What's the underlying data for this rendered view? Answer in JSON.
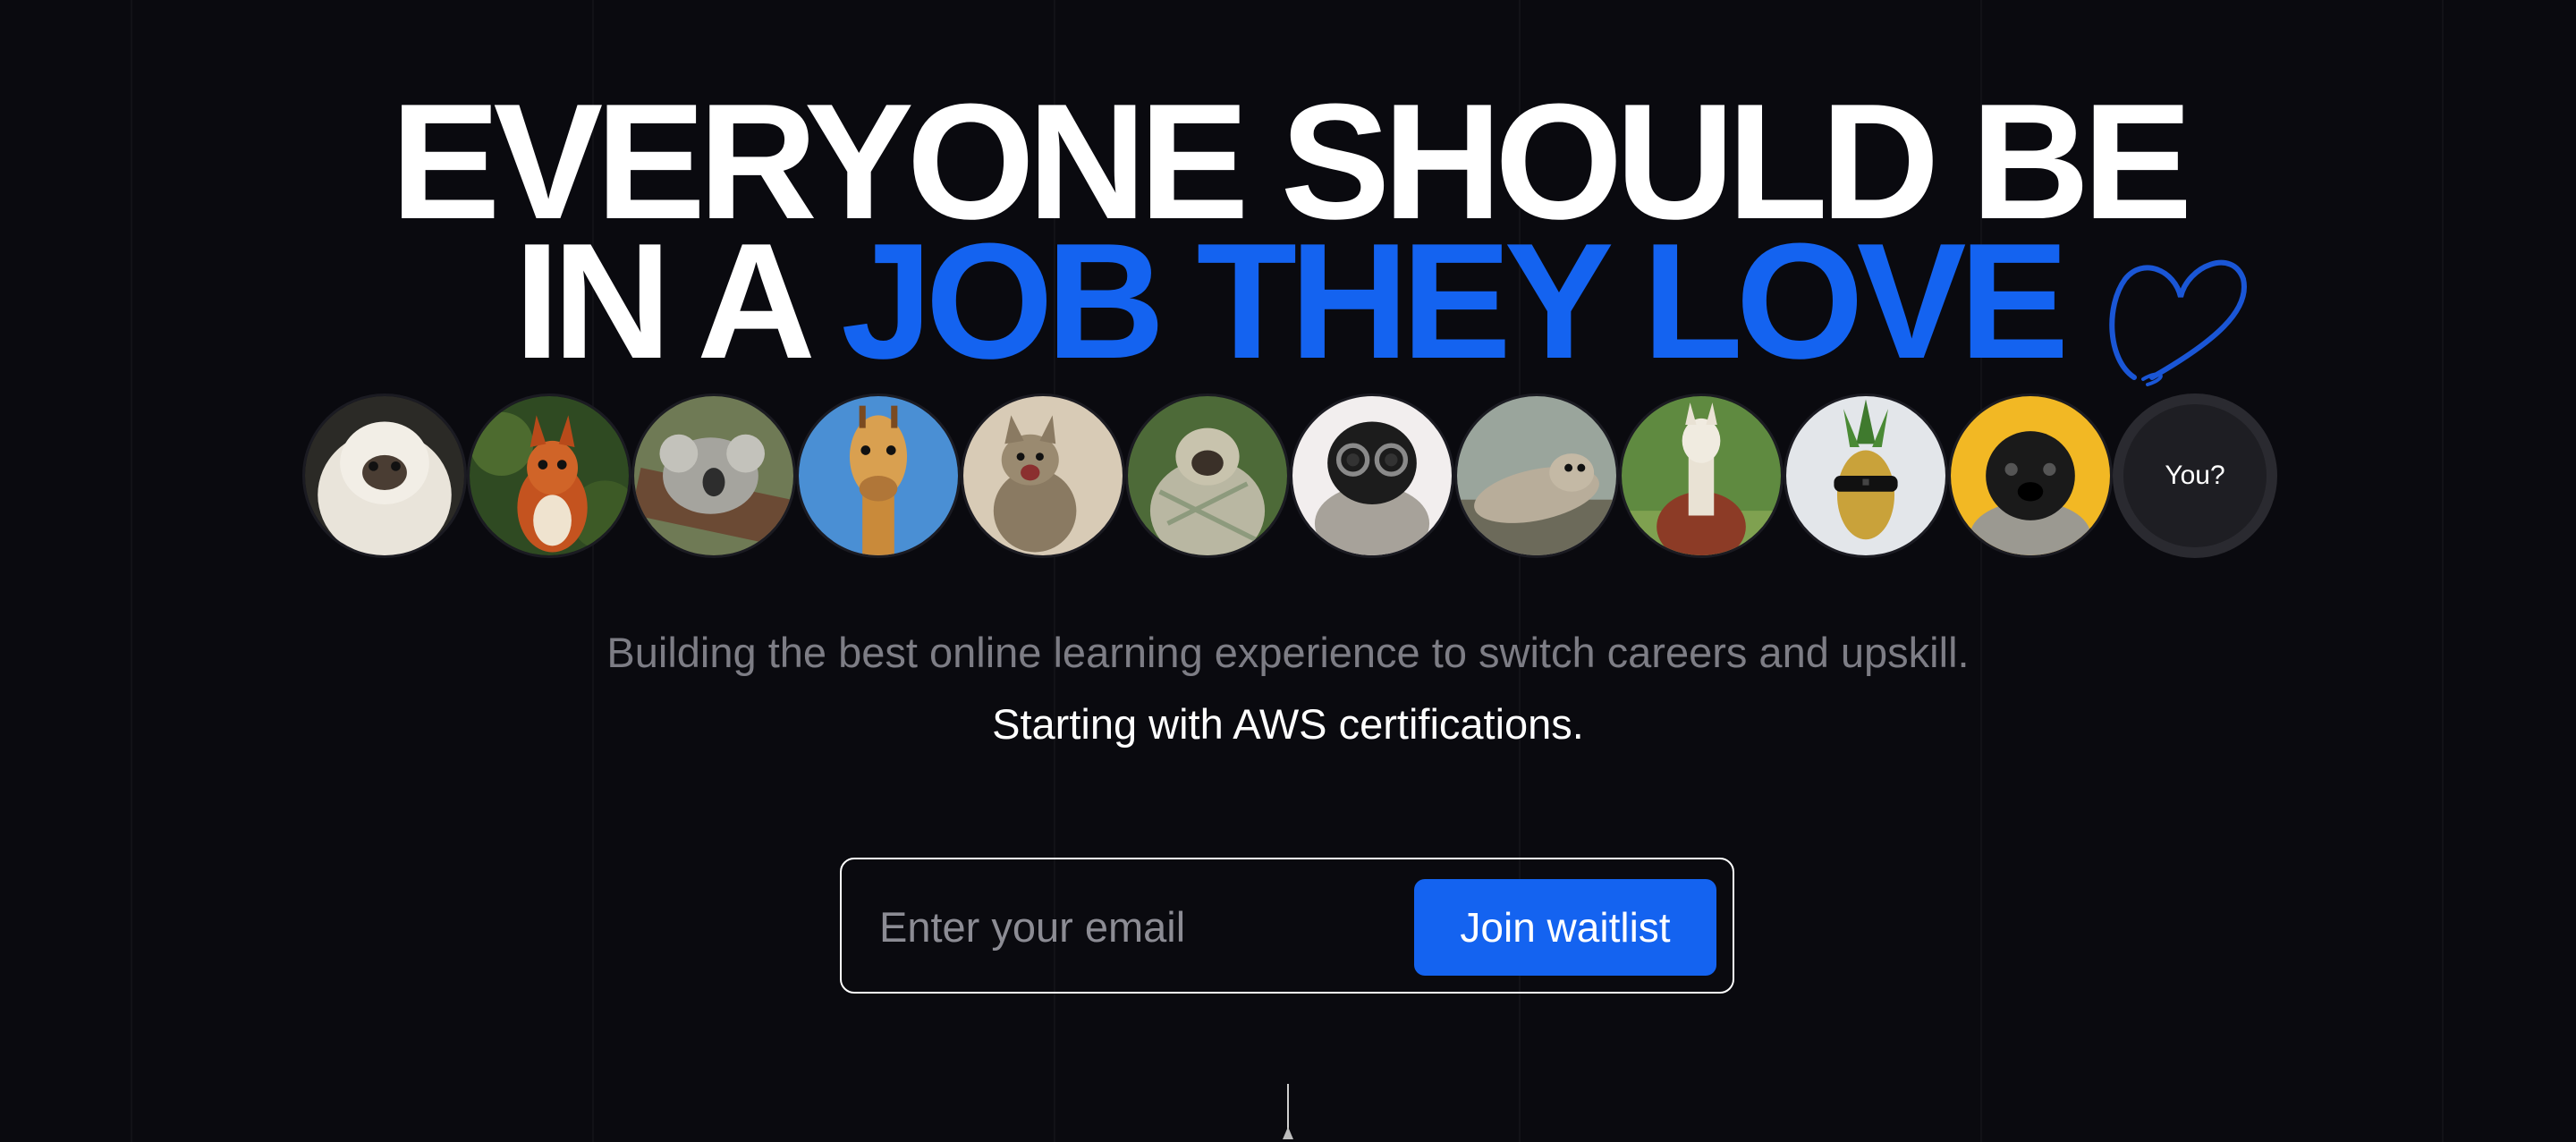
{
  "hero": {
    "line1": "EVERYONE SHOULD BE",
    "line2_prefix": "IN A ",
    "line2_accent": "JOB THEY LOVE"
  },
  "avatars": {
    "items": [
      {
        "name": "fluffy-dog-avatar"
      },
      {
        "name": "squirrel-avatar"
      },
      {
        "name": "koala-avatar"
      },
      {
        "name": "giraffe-avatar"
      },
      {
        "name": "kitten-avatar"
      },
      {
        "name": "pug-blanket-avatar"
      },
      {
        "name": "pug-glasses-avatar"
      },
      {
        "name": "seal-avatar"
      },
      {
        "name": "alpaca-avatar"
      },
      {
        "name": "pineapple-avatar"
      },
      {
        "name": "pug-yellow-avatar"
      }
    ],
    "you_label": "You?"
  },
  "subtitle": "Building the best online learning experience to switch careers and upskill.",
  "subtitle2": "Starting with AWS certifications.",
  "waitlist": {
    "email_placeholder": "Enter your email",
    "button_label": "Join waitlist"
  },
  "colors": {
    "background": "#0a0a0f",
    "accent": "#1463f0",
    "muted_text": "#7d7d85"
  }
}
